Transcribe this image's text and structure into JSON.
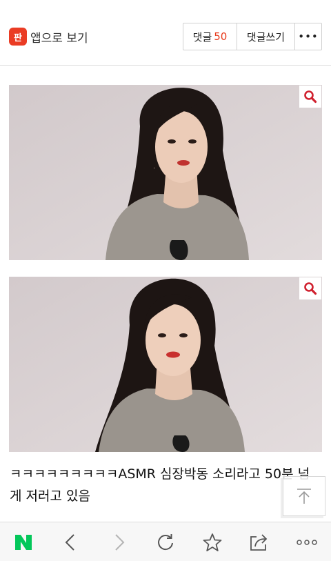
{
  "header": {
    "app_logo": "판",
    "app_label": "앱으로 보기",
    "comments_label": "댓글",
    "comments_count": "50",
    "write_label": "댓글쓰기",
    "more_label": "•••"
  },
  "post": {
    "caption": "ㅋㅋㅋㅋㅋㅋㅋㅋㅋASMR 심장박동 소리라고 50분 넘게 저러고 있음"
  },
  "colors": {
    "accent": "#e8391b",
    "logo": "#ea3c24",
    "naver_green": "#03c75a"
  },
  "icons": {
    "zoom": "magnifier-icon",
    "scroll_top": "arrow-up-icon",
    "toolbar": [
      "naver-n-icon",
      "back-icon",
      "forward-icon",
      "refresh-icon",
      "star-icon",
      "share-icon",
      "more-icon"
    ]
  }
}
